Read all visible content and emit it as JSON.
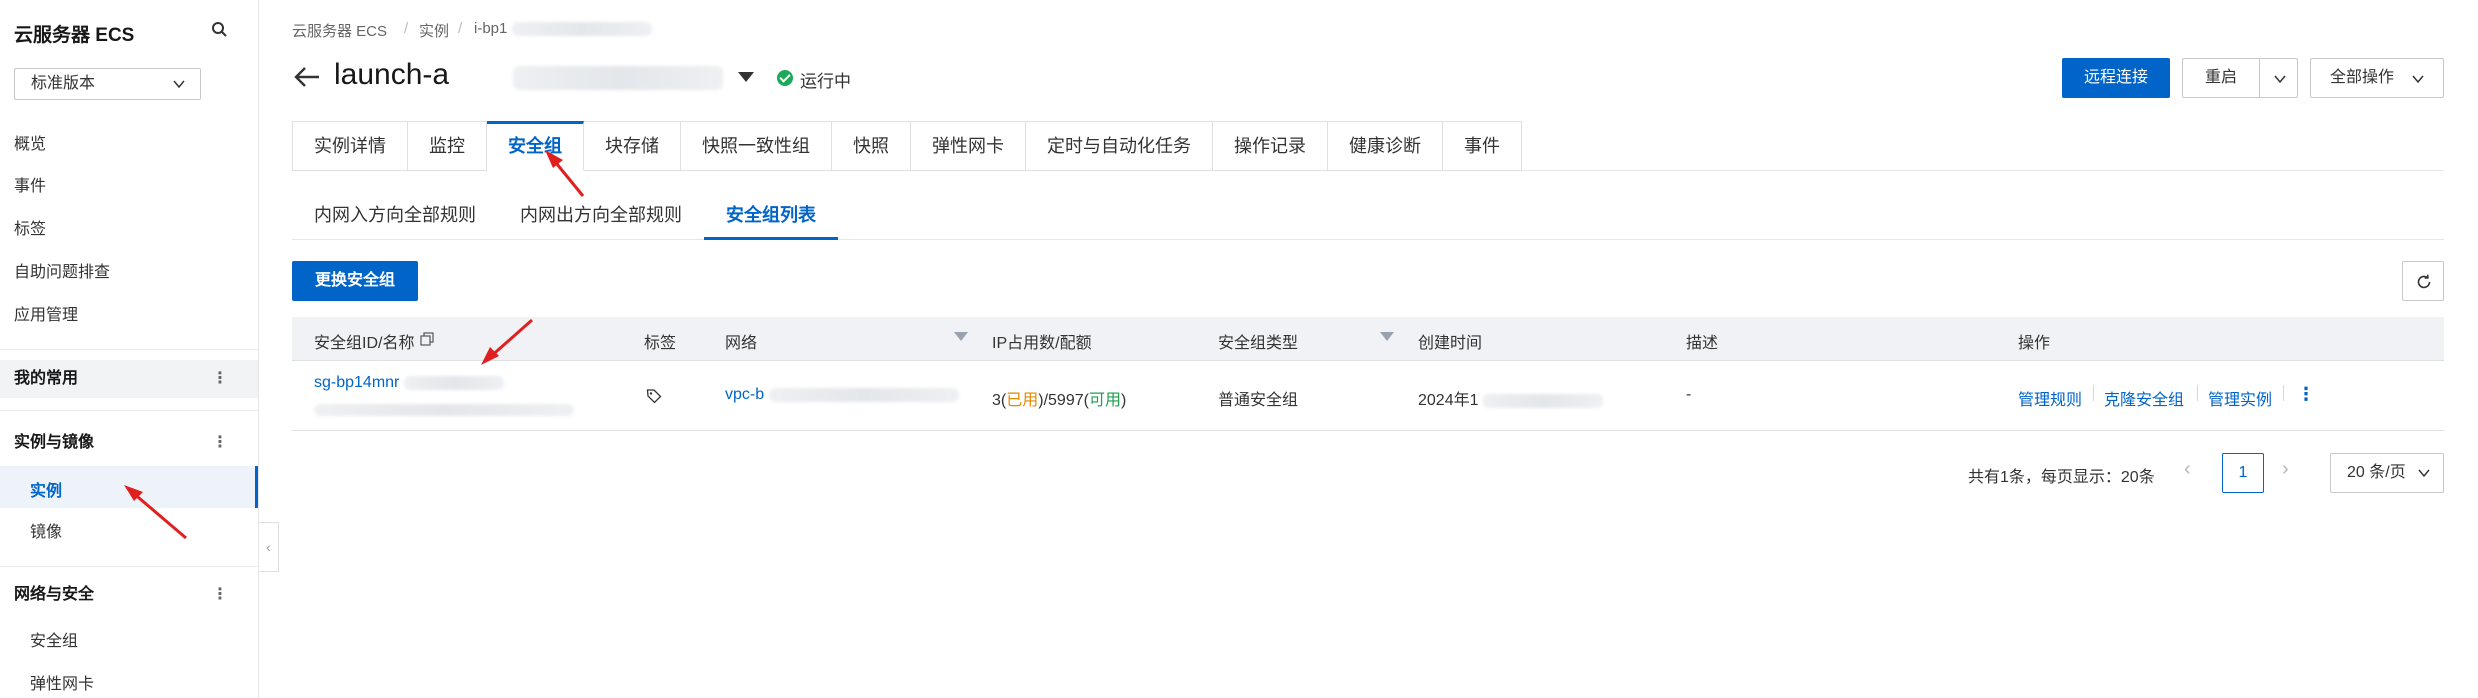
{
  "sidebar": {
    "title": "云服务器 ECS",
    "version": "标准版本",
    "items": [
      "概览",
      "事件",
      "标签",
      "自助问题排查",
      "应用管理"
    ],
    "groups": {
      "favorites": "我的常用",
      "instances_images": "实例与镜像",
      "network_security": "网络与安全"
    },
    "instances_images_items": [
      "实例",
      "镜像"
    ],
    "network_security_items": [
      "安全组",
      "弹性网卡"
    ]
  },
  "breadcrumb": [
    "云服务器 ECS",
    "实例",
    "i-bp1"
  ],
  "header": {
    "title": "launch-a",
    "status": "运行中",
    "status_color": "#1ea85a",
    "remote_connect": "远程连接",
    "restart": "重启",
    "all_actions": "全部操作"
  },
  "tabs": [
    "实例详情",
    "监控",
    "安全组",
    "块存储",
    "快照一致性组",
    "快照",
    "弹性网卡",
    "定时与自动化任务",
    "操作记录",
    "健康诊断",
    "事件"
  ],
  "active_tab": "安全组",
  "subtabs": [
    "内网入方向全部规则",
    "内网出方向全部规则",
    "安全组列表"
  ],
  "active_subtab": "安全组列表",
  "toolbar": {
    "change_sg": "更换安全组"
  },
  "table": {
    "headers": {
      "id_name": "安全组ID/名称",
      "tags": "标签",
      "network": "网络",
      "ip_quota": "IP占用数/配额",
      "sg_type": "安全组类型",
      "created": "创建时间",
      "desc": "描述",
      "actions": "操作"
    },
    "row": {
      "sg_id": "sg-bp14mnr",
      "vpc": "vpc-b",
      "ip_used": "3",
      "used_label": "已用",
      "ip_total": "/5997",
      "avail_label": "可用",
      "sg_type": "普通安全组",
      "created": "2024年1",
      "desc": "-",
      "action_manage_rules": "管理规则",
      "action_clone": "克隆安全组",
      "action_manage_instances": "管理实例"
    }
  },
  "pagination": {
    "summary": "共有1条，每页显示：20条",
    "current": "1",
    "page_size": "20 条/页"
  },
  "colors": {
    "accent": "#0064c8",
    "annotation_arrow": "#e02020"
  }
}
